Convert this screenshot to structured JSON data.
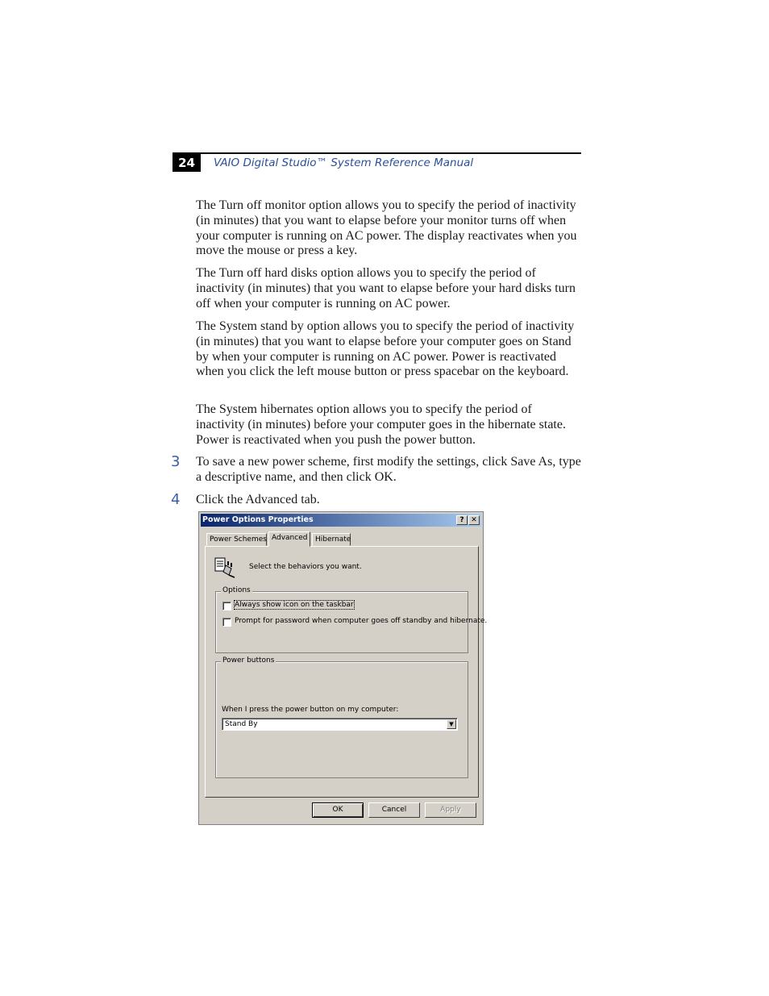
{
  "header": {
    "page_number": "24",
    "running_title": "VAIO Digital Studio™ System Reference Manual"
  },
  "body": {
    "paragraphs": [
      "The Turn off monitor option allows you to specify the period of inactivity (in minutes) that you want to elapse before your monitor turns off when your computer is running on AC power. The display reactivates when you move the mouse or press a key.",
      "The Turn off hard disks option allows you to specify the period of inactivity (in minutes) that you want to elapse before your hard disks turn off when your computer is running on AC power.",
      "The System stand by option allows you to specify the period of inactivity (in minutes) that you want to elapse before your computer goes on Stand by when your computer is running on AC power. Power is reactivated when you click the left mouse button or press spacebar on the keyboard.",
      "The System hibernates option allows you to specify the period of inactivity (in minutes) before your computer goes in the hibernate state. Power is reactivated when you push the power button."
    ],
    "steps": [
      {
        "number": "3",
        "text": "To save a new power scheme, first modify the settings, click Save As, type a descriptive name, and then click OK."
      },
      {
        "number": "4",
        "text": "Click the Advanced tab."
      }
    ]
  },
  "dialog": {
    "title": "Power Options Properties",
    "help_glyph": "?",
    "close_glyph": "✕",
    "tabs": [
      "Power Schemes",
      "Advanced",
      "Hibernate"
    ],
    "active_tab": "Advanced",
    "intro_text": "Select the behaviors you want.",
    "options": {
      "legend": "Options",
      "items": [
        {
          "label": "Always show icon on the taskbar",
          "checked": false
        },
        {
          "label": "Prompt for password when computer goes off standby and hibernate.",
          "checked": false
        }
      ]
    },
    "power_buttons": {
      "legend": "Power buttons",
      "prompt": "When I press the power button on my computer:",
      "selected": "Stand By",
      "arrow_glyph": "▼"
    },
    "buttons": {
      "ok": "OK",
      "cancel": "Cancel",
      "apply": "Apply"
    },
    "colors": {
      "face": "#d4d0c8",
      "title_start": "#0a246a",
      "title_end": "#a6caf0"
    }
  }
}
